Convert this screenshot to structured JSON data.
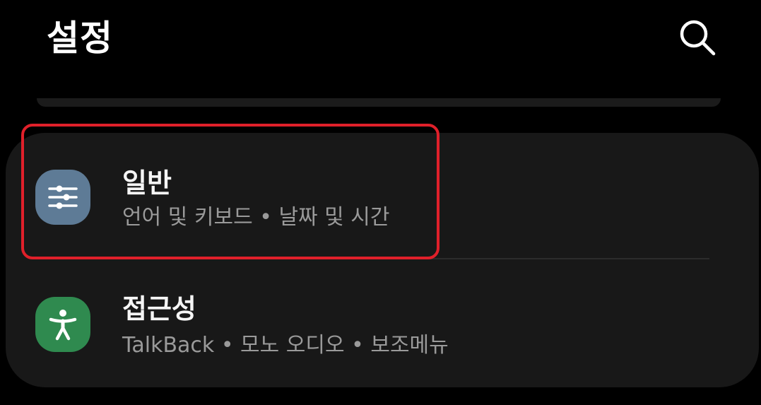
{
  "header": {
    "title": "설정",
    "search_icon": "search-icon"
  },
  "colors": {
    "background": "#000000",
    "card": "#181818",
    "general_icon_bg": "#5e7b96",
    "accessibility_icon_bg": "#2f8a4f",
    "highlight": "#e0202a"
  },
  "settings": {
    "items": [
      {
        "title": "일반",
        "subtitle": "언어 및 키보드 • 날짜 및 시간",
        "icon": "sliders-icon"
      },
      {
        "title": "접근성",
        "subtitle": "TalkBack • 모노 오디오 • 보조메뉴",
        "icon": "accessibility-icon"
      }
    ]
  }
}
